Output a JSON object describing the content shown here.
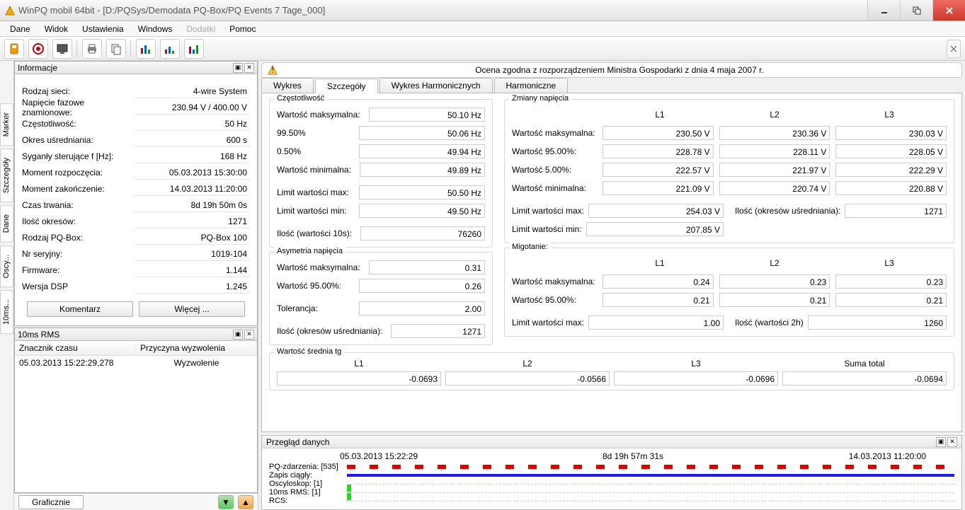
{
  "window": {
    "title": "WinPQ mobil 64bit - [D:/PQSys/Demodata PQ-Box/PQ Events 7 Tage_000]"
  },
  "menu": {
    "items": [
      "Dane",
      "Widok",
      "Ustawienia",
      "Windows",
      "Dodatki",
      "Pomoc"
    ],
    "dim_index": 4
  },
  "sidetabs": [
    "Marker",
    "Szczegóły",
    "Dane",
    "Oscy...",
    "10ms..."
  ],
  "info_panel": {
    "title": "Informacje",
    "rows": [
      {
        "label": "Rodzaj sieci:",
        "value": "4-wire System"
      },
      {
        "label": "Napięcie fazowe znamionowe:",
        "value": "230.94 V / 400.00 V"
      },
      {
        "label": "Częstotliwość:",
        "value": "50 Hz"
      },
      {
        "label": "Okres uśredniania:",
        "value": "600 s"
      },
      {
        "label": "Syganły sterujące f [Hz]:",
        "value": "168 Hz"
      },
      {
        "label": "Moment rozpoczęcia:",
        "value": "05.03.2013 15:30:00"
      },
      {
        "label": "Moment zakończenie:",
        "value": "14.03.2013 11:20:00"
      },
      {
        "label": "Czas trwania:",
        "value": "8d 19h 50m 0s"
      },
      {
        "label": "Ilość okresów:",
        "value": "1271"
      },
      {
        "label": "Rodzaj PQ-Box:",
        "value": "PQ-Box 100"
      },
      {
        "label": "Nr seryjny:",
        "value": "1019-104"
      },
      {
        "label": "Firmware:",
        "value": "1.144"
      },
      {
        "label": "Wersja DSP",
        "value": "1.245"
      }
    ],
    "comment_btn": "Komentarz",
    "more_btn": "Więcej ..."
  },
  "rms_panel": {
    "title": "10ms RMS",
    "header": [
      "Znacznik czasu",
      "Przyczyna wyzwolenia"
    ],
    "rows": [
      {
        "time": "05.03.2013 15:22:29,278",
        "reason": "Wyzwolenie"
      }
    ]
  },
  "graph_btn": "Graficznie",
  "assessment": "Ocena zgodna z rozporządzeniem Ministra Gospodarki z dnia 4 maja 2007 r.",
  "tabs": [
    "Wykres",
    "Szczegóły",
    "Wykres Harmonicznych",
    "Harmoniczne"
  ],
  "active_tab": 1,
  "details": {
    "freq": {
      "title": "Częstotliwość",
      "rows": [
        {
          "label": "Wartość maksymalna:",
          "value": "50.10 Hz"
        },
        {
          "label": "99.50%",
          "value": "50.06 Hz"
        },
        {
          "label": "0.50%",
          "value": "49.94 Hz"
        },
        {
          "label": "Wartość minimalna:",
          "value": "49.89 Hz"
        },
        {
          "label": "Limit wartości max:",
          "value": "50.50 Hz"
        },
        {
          "label": "Limit wartości min:",
          "value": "49.50 Hz"
        },
        {
          "label": "Ilość (wartości 10s):",
          "value": "76260"
        }
      ]
    },
    "asym": {
      "title": "Asymetria napięcia",
      "rows": [
        {
          "label": "Wartość maksymalna:",
          "value": "0.31"
        },
        {
          "label": "Wartość 95.00%:",
          "value": "0.26"
        },
        {
          "label": "Tolerancja:",
          "value": "2.00"
        },
        {
          "label": "Ilość (okresów uśredniania):",
          "value": "1271"
        }
      ]
    },
    "voltage": {
      "title": "Zmiany napięcia",
      "cols": [
        "L1",
        "L2",
        "L3"
      ],
      "rows": [
        {
          "label": "Wartość maksymalna:",
          "vals": [
            "230.50 V",
            "230.36 V",
            "230.03 V"
          ]
        },
        {
          "label": "Wartość 95.00%:",
          "vals": [
            "228.78 V",
            "228.11 V",
            "228.05 V"
          ]
        },
        {
          "label": "Wartość 5.00%:",
          "vals": [
            "222.57 V",
            "221.97 V",
            "222.29 V"
          ]
        },
        {
          "label": "Wartość minimalna:",
          "vals": [
            "221.09 V",
            "220.74 V",
            "220.88 V"
          ]
        }
      ],
      "limit_max": {
        "label": "Limit wartości max:",
        "value": "254.03 V",
        "label2": "Ilość (okresów uśredniania):",
        "value2": "1271"
      },
      "limit_min": {
        "label": "Limit wartości min:",
        "value": "207.85 V"
      }
    },
    "flicker": {
      "title": "Migotanie:",
      "cols": [
        "L1",
        "L2",
        "L3"
      ],
      "rows": [
        {
          "label": "Wartość maksymalna:",
          "vals": [
            "0.24",
            "0.23",
            "0.23"
          ]
        },
        {
          "label": "Wartość 95.00%:",
          "vals": [
            "0.21",
            "0.21",
            "0.21"
          ]
        }
      ],
      "limit": {
        "label": "Limit wartości max:",
        "value": "1.00",
        "label2": "Ilość (wartości 2h)",
        "value2": "1260"
      }
    },
    "tg": {
      "title": "Wartość średnia tg",
      "cols": [
        "L1",
        "L2",
        "L3",
        "Suma total"
      ],
      "vals": [
        "-0.0693",
        "-0.0566",
        "-0.0696",
        "-0.0694"
      ]
    }
  },
  "overview": {
    "title": "Przegląd danych",
    "start": "05.03.2013 15:22:29",
    "duration": "8d 19h 57m 31s",
    "end": "14.03.2013 11:20:00",
    "tracks": [
      "PQ-zdarzenia:  [535]",
      "Zapis ciągły:",
      "Oscyloskop:  [1]",
      "10ms RMS:  [1]",
      "RCS:"
    ]
  }
}
